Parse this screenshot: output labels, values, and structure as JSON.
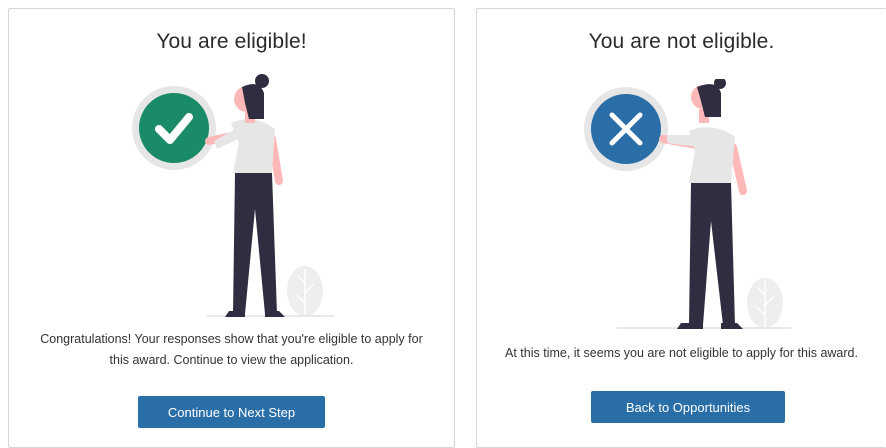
{
  "eligible_card": {
    "title": "You are eligible!",
    "message_line1": "Congratulations! Your responses show that you're eligible to apply for",
    "message_line2": "this award. Continue to view the application.",
    "button_label": "Continue to Next Step",
    "status_icon": "check-icon",
    "status_color": "#1a8a68"
  },
  "not_eligible_card": {
    "title": "You are not eligible.",
    "message": "At this time, it seems you are not eligible to apply for this award.",
    "button_label": "Back to Opportunities",
    "status_icon": "x-icon",
    "status_color": "#2a6ea7"
  },
  "colors": {
    "button": "#2a6ea7",
    "figure_hair": "#2f2e41",
    "figure_skin": "#ffb8b8",
    "figure_shirt": "#e6e6e6",
    "figure_pants": "#2f2e41"
  }
}
